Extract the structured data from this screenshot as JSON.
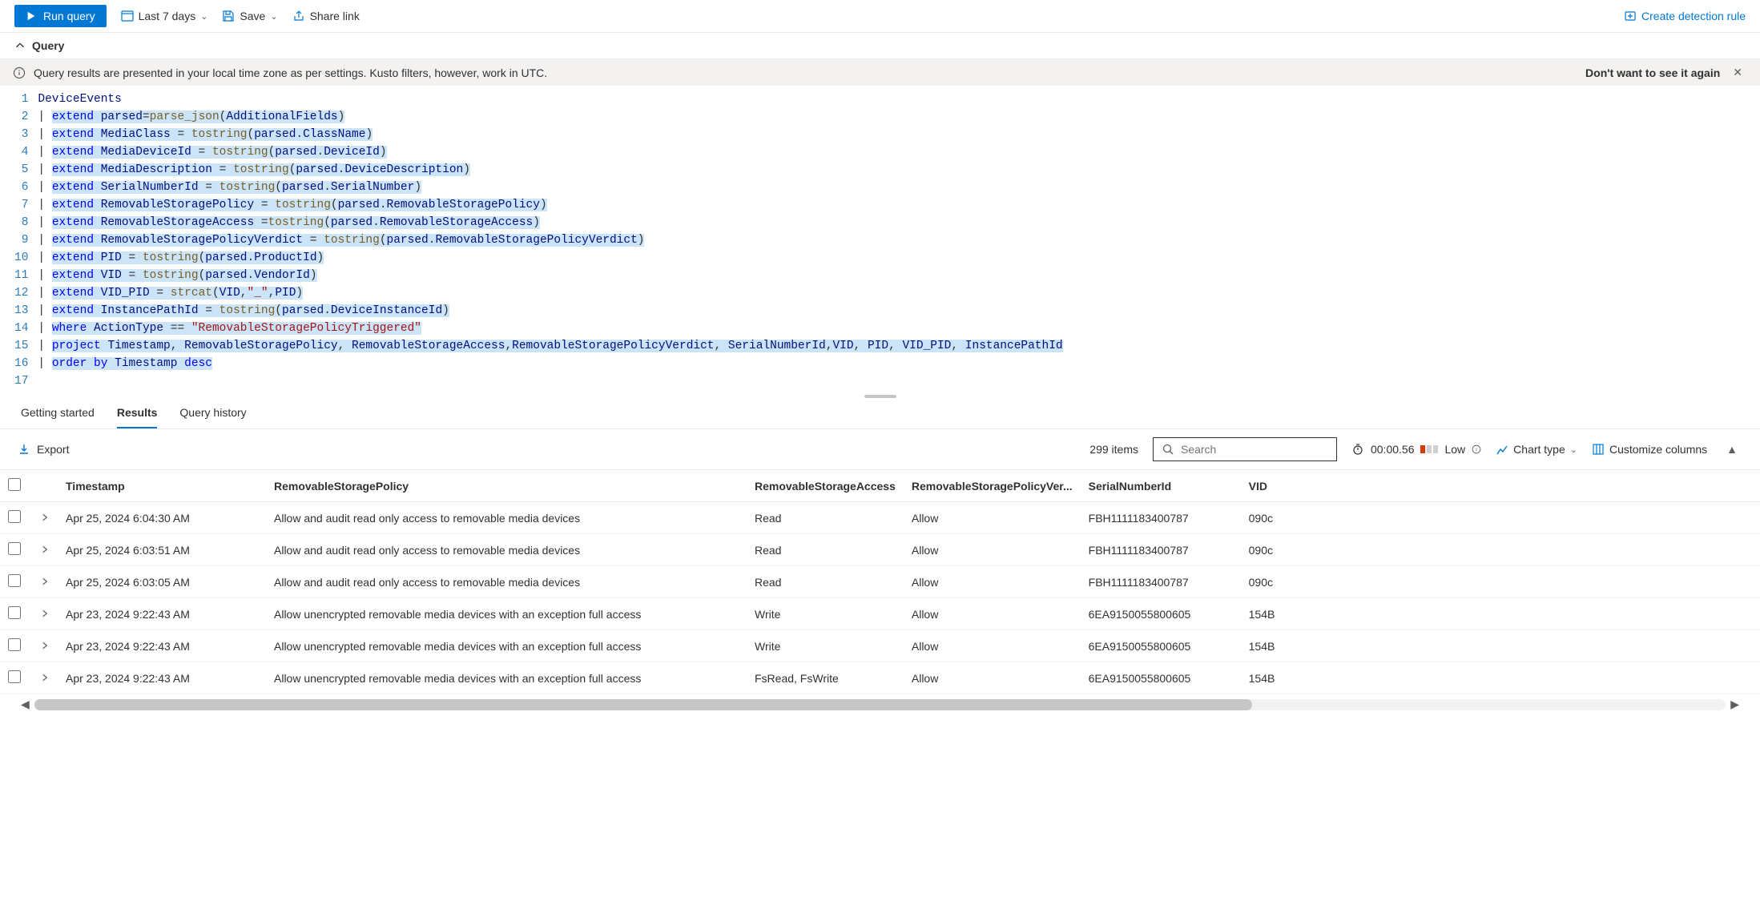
{
  "toolbar": {
    "run": "Run query",
    "time_range": "Last 7 days",
    "save": "Save",
    "share": "Share link",
    "create_rule": "Create detection rule"
  },
  "section": {
    "title": "Query"
  },
  "info": {
    "text": "Query results are presented in your local time zone as per settings. Kusto filters, however, work in UTC.",
    "dismiss": "Don't want to see it again"
  },
  "code": {
    "lines": [
      [
        {
          "t": "id",
          "v": "DeviceEvents"
        }
      ],
      [
        {
          "t": "op",
          "v": "|·"
        },
        {
          "t": "kw",
          "v": "extend",
          "sel": true
        },
        {
          "t": "op",
          "v": "·",
          "sel": true
        },
        {
          "t": "id",
          "v": "parsed",
          "sel": true
        },
        {
          "t": "op",
          "v": "=",
          "sel": true
        },
        {
          "t": "fn",
          "v": "parse_json",
          "sel": true
        },
        {
          "t": "op",
          "v": "(",
          "sel": true
        },
        {
          "t": "id",
          "v": "AdditionalFields",
          "sel": true
        },
        {
          "t": "op",
          "v": ")",
          "sel": true
        }
      ],
      [
        {
          "t": "op",
          "v": "|·"
        },
        {
          "t": "kw",
          "v": "extend",
          "sel": true
        },
        {
          "t": "op",
          "v": "·",
          "sel": true
        },
        {
          "t": "id",
          "v": "MediaClass",
          "sel": true
        },
        {
          "t": "op",
          "v": "·=·",
          "sel": true
        },
        {
          "t": "fn",
          "v": "tostring",
          "sel": true
        },
        {
          "t": "op",
          "v": "(",
          "sel": true
        },
        {
          "t": "id",
          "v": "parsed",
          "sel": true
        },
        {
          "t": "op",
          "v": ".",
          "sel": true
        },
        {
          "t": "id",
          "v": "ClassName",
          "sel": true
        },
        {
          "t": "op",
          "v": ")",
          "sel": true
        }
      ],
      [
        {
          "t": "op",
          "v": "|·"
        },
        {
          "t": "kw",
          "v": "extend",
          "sel": true
        },
        {
          "t": "op",
          "v": "·",
          "sel": true
        },
        {
          "t": "id",
          "v": "MediaDeviceId",
          "sel": true
        },
        {
          "t": "op",
          "v": "·=·",
          "sel": true
        },
        {
          "t": "fn",
          "v": "tostring",
          "sel": true
        },
        {
          "t": "op",
          "v": "(",
          "sel": true
        },
        {
          "t": "id",
          "v": "parsed",
          "sel": true
        },
        {
          "t": "op",
          "v": ".",
          "sel": true
        },
        {
          "t": "id",
          "v": "DeviceId",
          "sel": true
        },
        {
          "t": "op",
          "v": ")",
          "sel": true
        }
      ],
      [
        {
          "t": "op",
          "v": "|·"
        },
        {
          "t": "kw",
          "v": "extend",
          "sel": true
        },
        {
          "t": "op",
          "v": "·",
          "sel": true
        },
        {
          "t": "id",
          "v": "MediaDescription",
          "sel": true
        },
        {
          "t": "op",
          "v": "·=·",
          "sel": true
        },
        {
          "t": "fn",
          "v": "tostring",
          "sel": true
        },
        {
          "t": "op",
          "v": "(",
          "sel": true
        },
        {
          "t": "id",
          "v": "parsed",
          "sel": true
        },
        {
          "t": "op",
          "v": ".",
          "sel": true
        },
        {
          "t": "id",
          "v": "DeviceDescription",
          "sel": true
        },
        {
          "t": "op",
          "v": ")",
          "sel": true
        }
      ],
      [
        {
          "t": "op",
          "v": "|·"
        },
        {
          "t": "kw",
          "v": "extend",
          "sel": true
        },
        {
          "t": "op",
          "v": "·",
          "sel": true
        },
        {
          "t": "id",
          "v": "SerialNumberId",
          "sel": true
        },
        {
          "t": "op",
          "v": "·=·",
          "sel": true
        },
        {
          "t": "fn",
          "v": "tostring",
          "sel": true
        },
        {
          "t": "op",
          "v": "(",
          "sel": true
        },
        {
          "t": "id",
          "v": "parsed",
          "sel": true
        },
        {
          "t": "op",
          "v": ".",
          "sel": true
        },
        {
          "t": "id",
          "v": "SerialNumber",
          "sel": true
        },
        {
          "t": "op",
          "v": ")",
          "sel": true
        }
      ],
      [
        {
          "t": "op",
          "v": "|·"
        },
        {
          "t": "kw",
          "v": "extend",
          "sel": true
        },
        {
          "t": "op",
          "v": "·",
          "sel": true
        },
        {
          "t": "id",
          "v": "RemovableStoragePolicy",
          "sel": true
        },
        {
          "t": "op",
          "v": "·=·",
          "sel": true
        },
        {
          "t": "fn",
          "v": "tostring",
          "sel": true
        },
        {
          "t": "op",
          "v": "(",
          "sel": true
        },
        {
          "t": "id",
          "v": "parsed",
          "sel": true
        },
        {
          "t": "op",
          "v": ".",
          "sel": true
        },
        {
          "t": "id",
          "v": "RemovableStoragePolicy",
          "sel": true
        },
        {
          "t": "op",
          "v": ")",
          "sel": true
        }
      ],
      [
        {
          "t": "op",
          "v": "|·"
        },
        {
          "t": "kw",
          "v": "extend",
          "sel": true
        },
        {
          "t": "op",
          "v": "·",
          "sel": true
        },
        {
          "t": "id",
          "v": "RemovableStorageAccess",
          "sel": true
        },
        {
          "t": "op",
          "v": "·=",
          "sel": true
        },
        {
          "t": "fn",
          "v": "tostring",
          "sel": true
        },
        {
          "t": "op",
          "v": "(",
          "sel": true
        },
        {
          "t": "id",
          "v": "parsed",
          "sel": true
        },
        {
          "t": "op",
          "v": ".",
          "sel": true
        },
        {
          "t": "id",
          "v": "RemovableStorageAccess",
          "sel": true
        },
        {
          "t": "op",
          "v": ")",
          "sel": true
        }
      ],
      [
        {
          "t": "op",
          "v": "|·"
        },
        {
          "t": "kw",
          "v": "extend",
          "sel": true
        },
        {
          "t": "op",
          "v": "·",
          "sel": true
        },
        {
          "t": "id",
          "v": "RemovableStoragePolicyVerdict",
          "sel": true
        },
        {
          "t": "op",
          "v": "·=·",
          "sel": true
        },
        {
          "t": "fn",
          "v": "tostring",
          "sel": true
        },
        {
          "t": "op",
          "v": "(",
          "sel": true
        },
        {
          "t": "id",
          "v": "parsed",
          "sel": true
        },
        {
          "t": "op",
          "v": ".",
          "sel": true
        },
        {
          "t": "id",
          "v": "RemovableStoragePolicyVerdict",
          "sel": true
        },
        {
          "t": "op",
          "v": ")",
          "sel": true
        }
      ],
      [
        {
          "t": "op",
          "v": "|·"
        },
        {
          "t": "kw",
          "v": "extend",
          "sel": true
        },
        {
          "t": "op",
          "v": "·",
          "sel": true
        },
        {
          "t": "id",
          "v": "PID",
          "sel": true
        },
        {
          "t": "op",
          "v": "·=·",
          "sel": true
        },
        {
          "t": "fn",
          "v": "tostring",
          "sel": true
        },
        {
          "t": "op",
          "v": "(",
          "sel": true
        },
        {
          "t": "id",
          "v": "parsed",
          "sel": true
        },
        {
          "t": "op",
          "v": ".",
          "sel": true
        },
        {
          "t": "id",
          "v": "ProductId",
          "sel": true
        },
        {
          "t": "op",
          "v": ")",
          "sel": true
        }
      ],
      [
        {
          "t": "op",
          "v": "|·"
        },
        {
          "t": "kw",
          "v": "extend",
          "sel": true
        },
        {
          "t": "op",
          "v": "·",
          "sel": true
        },
        {
          "t": "id",
          "v": "VID",
          "sel": true
        },
        {
          "t": "op",
          "v": "·=·",
          "sel": true
        },
        {
          "t": "fn",
          "v": "tostring",
          "sel": true
        },
        {
          "t": "op",
          "v": "(",
          "sel": true
        },
        {
          "t": "id",
          "v": "parsed",
          "sel": true
        },
        {
          "t": "op",
          "v": ".",
          "sel": true
        },
        {
          "t": "id",
          "v": "VendorId",
          "sel": true
        },
        {
          "t": "op",
          "v": ")",
          "sel": true
        }
      ],
      [
        {
          "t": "op",
          "v": "|·"
        },
        {
          "t": "kw",
          "v": "extend",
          "sel": true
        },
        {
          "t": "op",
          "v": "·",
          "sel": true
        },
        {
          "t": "id",
          "v": "VID_PID",
          "sel": true
        },
        {
          "t": "op",
          "v": "·=·",
          "sel": true
        },
        {
          "t": "fn",
          "v": "strcat",
          "sel": true
        },
        {
          "t": "op",
          "v": "(",
          "sel": true
        },
        {
          "t": "id",
          "v": "VID",
          "sel": true
        },
        {
          "t": "op",
          "v": ",",
          "sel": true
        },
        {
          "t": "str",
          "v": "\"_\"",
          "sel": true
        },
        {
          "t": "op",
          "v": ",",
          "sel": true
        },
        {
          "t": "id",
          "v": "PID",
          "sel": true
        },
        {
          "t": "op",
          "v": ")",
          "sel": true
        }
      ],
      [
        {
          "t": "op",
          "v": "|·"
        },
        {
          "t": "kw",
          "v": "extend",
          "sel": true
        },
        {
          "t": "op",
          "v": "·",
          "sel": true
        },
        {
          "t": "id",
          "v": "InstancePathId",
          "sel": true
        },
        {
          "t": "op",
          "v": "·=·",
          "sel": true
        },
        {
          "t": "fn",
          "v": "tostring",
          "sel": true
        },
        {
          "t": "op",
          "v": "(",
          "sel": true
        },
        {
          "t": "id",
          "v": "parsed",
          "sel": true
        },
        {
          "t": "op",
          "v": ".",
          "sel": true
        },
        {
          "t": "id",
          "v": "DeviceInstanceId",
          "sel": true
        },
        {
          "t": "op",
          "v": ")",
          "sel": true
        }
      ],
      [
        {
          "t": "op",
          "v": "|·"
        },
        {
          "t": "kw",
          "v": "where",
          "sel": true
        },
        {
          "t": "op",
          "v": "·",
          "sel": true
        },
        {
          "t": "id",
          "v": "ActionType",
          "sel": true
        },
        {
          "t": "op",
          "v": "·==·",
          "sel": true
        },
        {
          "t": "str",
          "v": "\"RemovableStoragePolicyTriggered\"",
          "sel": true
        }
      ],
      [
        {
          "t": "op",
          "v": "|·"
        },
        {
          "t": "kw",
          "v": "project",
          "sel": true
        },
        {
          "t": "op",
          "v": "·",
          "sel": true
        },
        {
          "t": "id",
          "v": "Timestamp",
          "sel": true
        },
        {
          "t": "op",
          "v": ",·",
          "sel": true
        },
        {
          "t": "id",
          "v": "RemovableStoragePolicy",
          "sel": true
        },
        {
          "t": "op",
          "v": ",·",
          "sel": true
        },
        {
          "t": "id",
          "v": "RemovableStorageAccess",
          "sel": true
        },
        {
          "t": "op",
          "v": ",",
          "sel": true
        },
        {
          "t": "id",
          "v": "RemovableStoragePolicyVerdict",
          "sel": true
        },
        {
          "t": "op",
          "v": ",·",
          "sel": true
        },
        {
          "t": "id",
          "v": "SerialNumberId",
          "sel": true
        },
        {
          "t": "op",
          "v": ",",
          "sel": true
        },
        {
          "t": "id",
          "v": "VID",
          "sel": true
        },
        {
          "t": "op",
          "v": ",·",
          "sel": true
        },
        {
          "t": "id",
          "v": "PID",
          "sel": true
        },
        {
          "t": "op",
          "v": ",·",
          "sel": true
        },
        {
          "t": "id",
          "v": "VID_PID",
          "sel": true
        },
        {
          "t": "op",
          "v": ",·",
          "sel": true
        },
        {
          "t": "id",
          "v": "InstancePathId",
          "sel": true
        }
      ],
      [
        {
          "t": "op",
          "v": "|·"
        },
        {
          "t": "kw",
          "v": "order by",
          "sel": true
        },
        {
          "t": "op",
          "v": "·",
          "sel": true
        },
        {
          "t": "id",
          "v": "Timestamp",
          "sel": true
        },
        {
          "t": "op",
          "v": "·",
          "sel": true
        },
        {
          "t": "kw",
          "v": "desc",
          "sel": true
        }
      ],
      []
    ]
  },
  "results_tabs": {
    "getting_started": "Getting started",
    "results": "Results",
    "history": "Query history",
    "active": "results"
  },
  "results_bar": {
    "export": "Export",
    "item_count": "299 items",
    "search_placeholder": "Search",
    "timer": "00:00.56",
    "perf_label": "Low",
    "chart_type": "Chart type",
    "customize": "Customize columns"
  },
  "table": {
    "columns": [
      "Timestamp",
      "RemovableStoragePolicy",
      "RemovableStorageAccess",
      "RemovableStoragePolicyVer...",
      "SerialNumberId",
      "VID"
    ],
    "rows": [
      {
        "ts": "Apr 25, 2024 6:04:30 AM",
        "policy": "Allow and audit read only access to removable media devices",
        "access": "Read",
        "verdict": "Allow",
        "serial": "FBH1111183400787",
        "vid": "090c"
      },
      {
        "ts": "Apr 25, 2024 6:03:51 AM",
        "policy": "Allow and audit read only access to removable media devices",
        "access": "Read",
        "verdict": "Allow",
        "serial": "FBH1111183400787",
        "vid": "090c"
      },
      {
        "ts": "Apr 25, 2024 6:03:05 AM",
        "policy": "Allow and audit read only access to removable media devices",
        "access": "Read",
        "verdict": "Allow",
        "serial": "FBH1111183400787",
        "vid": "090c"
      },
      {
        "ts": "Apr 23, 2024 9:22:43 AM",
        "policy": "Allow unencrypted removable media devices with an exception full access",
        "access": "Write",
        "verdict": "Allow",
        "serial": "6EA9150055800605",
        "vid": "154B"
      },
      {
        "ts": "Apr 23, 2024 9:22:43 AM",
        "policy": "Allow unencrypted removable media devices with an exception full access",
        "access": "Write",
        "verdict": "Allow",
        "serial": "6EA9150055800605",
        "vid": "154B"
      },
      {
        "ts": "Apr 23, 2024 9:22:43 AM",
        "policy": "Allow unencrypted removable media devices with an exception full access",
        "access": "FsRead, FsWrite",
        "verdict": "Allow",
        "serial": "6EA9150055800605",
        "vid": "154B"
      }
    ]
  }
}
